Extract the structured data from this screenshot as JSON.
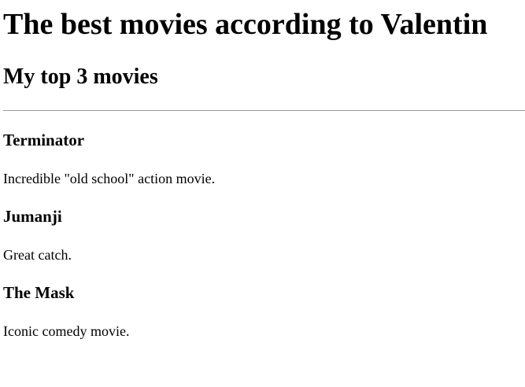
{
  "page": {
    "title": "The best movies according to Valentin",
    "subtitle": "My top 3 movies"
  },
  "movies": [
    {
      "title": "Terminator",
      "description": "Incredible \"old school\" action movie."
    },
    {
      "title": "Jumanji",
      "description": "Great catch."
    },
    {
      "title": "The Mask",
      "description": "Iconic comedy movie."
    }
  ]
}
